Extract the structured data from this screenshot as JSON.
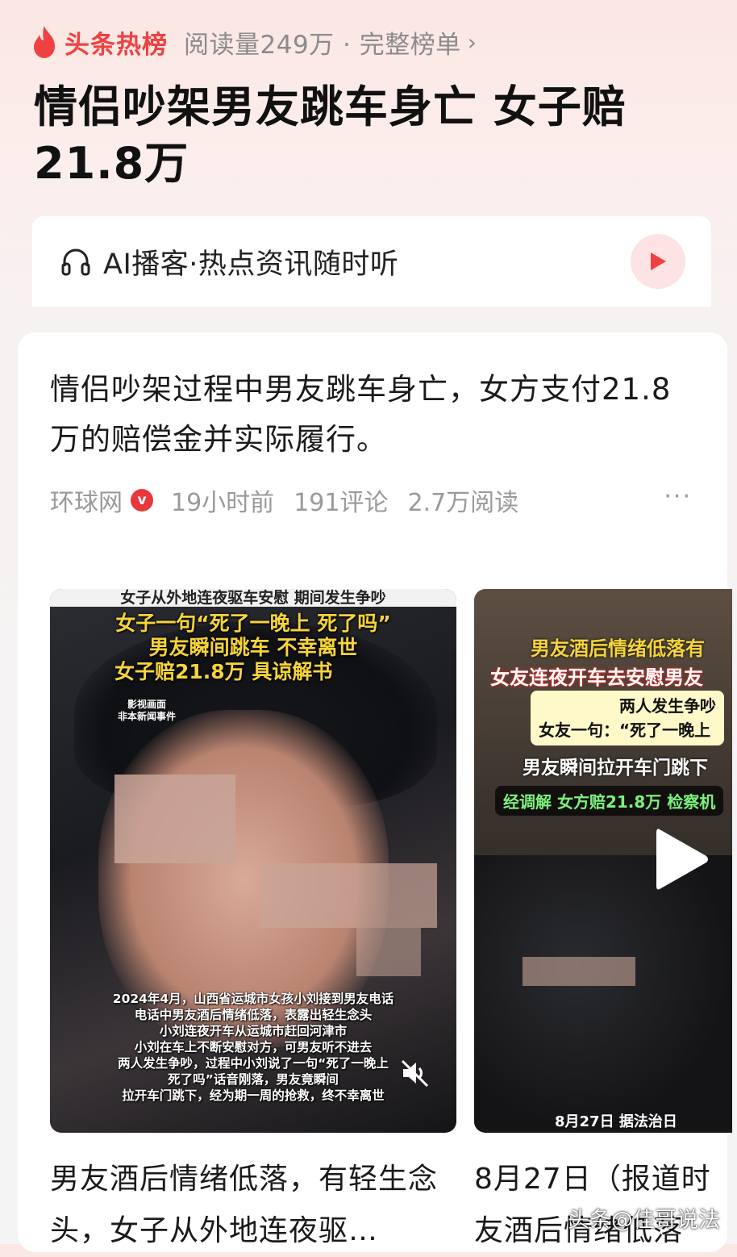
{
  "header": {
    "brand": "头条热榜",
    "reads": "阅读量249万 · 完整榜单",
    "chevron": "›",
    "title": "情侣吵架男友跳车身亡 女子赔21.8万"
  },
  "podcast": {
    "label": "AI播客·热点资讯随时听"
  },
  "article": {
    "summary": "情侣吵架过程中男友跳车身亡，女方支付21.8万的赔偿金并实际履行。",
    "source": "环球网",
    "verified_badge": "v",
    "time": "19小时前",
    "comments": "191评论",
    "reads": "2.7万阅读",
    "more": "···"
  },
  "video1": {
    "top_caption": "女子从外地连夜驱车安慰 期间发生争吵",
    "caption_line1": "女子一句“死了一晚上 死了吗”",
    "caption_line2": "男友瞬间跳车 不幸离世",
    "caption_line3": "女子赔21.8万       具谅解书",
    "disclaimer1": "影视画面",
    "disclaimer2": "非本新闻事件",
    "story": [
      "2024年4月，山西省运城市女孩小刘接到男友电话",
      "电话中男友酒后情绪低落，表露出轻生念头",
      "小刘连夜开车从运城市赶回河津市",
      "小刘在车上不断安慰对方，可男友听不进去",
      "两人发生争吵，过程中小刘说了一句“死了一晚上",
      "死了吗”话音刚落，男友竟瞬间",
      "拉开车门跳下，经为期一周的抢救，终不幸离世"
    ],
    "title": "男友酒后情绪低落，有轻生念头，女子从外地连夜驱…"
  },
  "video2": {
    "caption1": "男友酒后情绪低落有",
    "caption2": "女友连夜开车去安慰男友",
    "box_line1": "两人发生争吵",
    "box_line2": "女友一句：“死了一晚上",
    "caption3": "男友瞬间拉开车门跳下",
    "caption4": "经调解 女方赔21.8万 检察机",
    "date_caption": "8月27日    据法治日",
    "title": "8月27日（报道时友酒后情绪低落"
  },
  "watermark": "头条@佳哥说法",
  "colors": {
    "brand_red": "#f04142",
    "caption_yellow": "#f6d43a",
    "meta_gray": "#9a9a9a"
  }
}
